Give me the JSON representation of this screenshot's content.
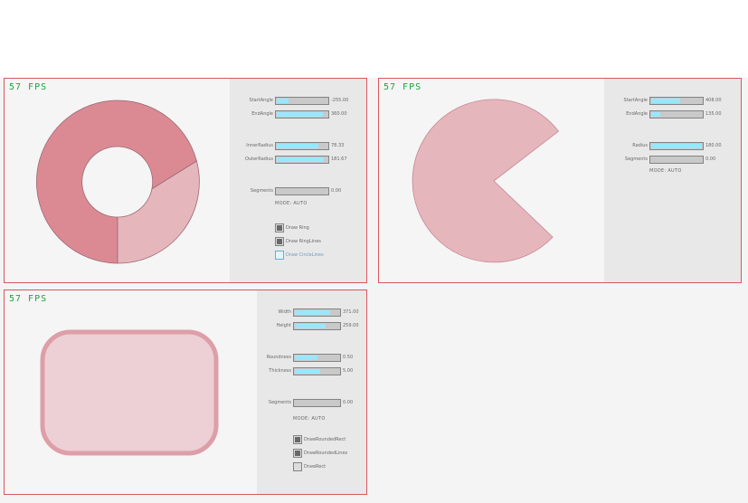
{
  "panels": {
    "ring": {
      "fps": "57 FPS",
      "sliders": [
        {
          "label": "StartAngle",
          "value": "-255.00",
          "fraction": 0.23
        },
        {
          "label": "EndAngle",
          "value": "360.00",
          "fraction": 0.88
        },
        {
          "label": "InnerRadius",
          "value": "78.33",
          "fraction": 0.79
        },
        {
          "label": "OuterRadius",
          "value": "181.67",
          "fraction": 0.9
        },
        {
          "label": "Segments",
          "value": "0.00",
          "fraction": 0.0
        }
      ],
      "mode": "MODE: AUTO",
      "checkboxes": [
        {
          "label": "Draw Ring",
          "checked": true
        },
        {
          "label": "Draw RingLines",
          "checked": true
        },
        {
          "label": "Draw CircleLines",
          "checked": false
        }
      ]
    },
    "sector": {
      "fps": "57 FPS",
      "sliders": [
        {
          "label": "StartAngle",
          "value": "408.00",
          "fraction": 0.56
        },
        {
          "label": "EndAngle",
          "value": "135.00",
          "fraction": 0.19
        },
        {
          "label": "Radius",
          "value": "180.00",
          "fraction": 0.97
        },
        {
          "label": "Segments",
          "value": "0.00",
          "fraction": 0.0
        }
      ],
      "mode": "MODE: AUTO"
    },
    "rect": {
      "fps": "57 FPS",
      "sliders": [
        {
          "label": "Width",
          "value": "371.00",
          "fraction": 0.77
        },
        {
          "label": "Height",
          "value": "259.00",
          "fraction": 0.67
        },
        {
          "label": "Roundness",
          "value": "0.50",
          "fraction": 0.5
        },
        {
          "label": "Thickness",
          "value": "5.00",
          "fraction": 0.55
        },
        {
          "label": "Segments",
          "value": "0.00",
          "fraction": 0.0
        }
      ],
      "mode": "MODE: AUTO",
      "checkboxes": [
        {
          "label": "DrawRoundedRect",
          "checked": true
        },
        {
          "label": "DrawRoundedLines",
          "checked": true
        },
        {
          "label": "DrawRect",
          "checked": false
        }
      ]
    }
  },
  "colors": {
    "panel_border": "#d8585c",
    "fps_green": "#1ea33a",
    "slider_fill": "#97e8ff",
    "shape_dark": "#db8a94",
    "shape_light": "#e6b6bd",
    "shape_line": "#9c6a72",
    "rect_fill": "#ecd0d5",
    "rect_border": "#de9ea8"
  }
}
